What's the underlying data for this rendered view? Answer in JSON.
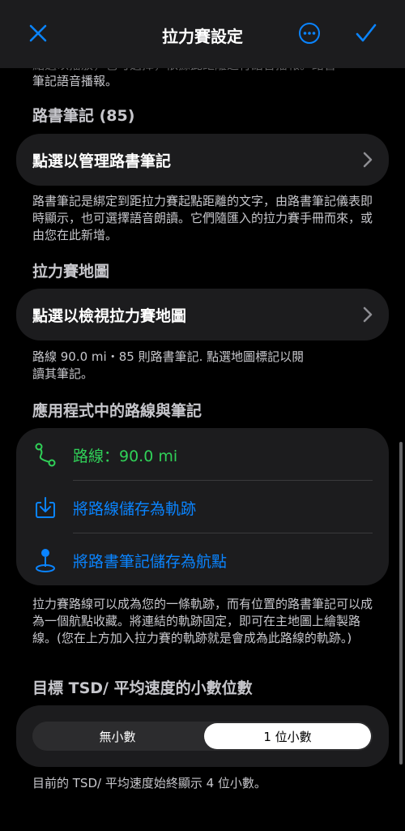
{
  "nav": {
    "title": "拉力賽設定",
    "close_icon": "close-icon",
    "more_icon": "more-icon",
    "done_icon": "checkmark-icon",
    "accent": "#0a84ff"
  },
  "clipped_text": {
    "line1": "點選以播放，也可選擇，依據此距離進行語音播報。路書",
    "line2": "筆記語音播報。"
  },
  "roadbook": {
    "header": "路書筆記 (85)",
    "button": "點選以管理路書筆記",
    "footnote": "路書筆記是綁定到距拉力賽起點距離的文字，由路書筆記儀表即時顯示，也可選擇語音朗讀。它們隨匯入的拉力賽手冊而來，或由您在此新增。"
  },
  "map": {
    "header": "拉力賽地圖",
    "button": "點選以檢視拉力賽地圖",
    "footnote": "路線 90.0 mi・85 則路書筆記. 點選地圖標記以閱讀其筆記。"
  },
  "route": {
    "header": "應用程式中的路線與筆記",
    "route_label": "路線：90.0 mi",
    "route_color": "#30d158",
    "save_track": "將路線儲存為軌跡",
    "save_waypoints": "將路書筆記儲存為航點",
    "link_color": "#0a84ff",
    "footnote": "拉力賽路線可以成為您的一條軌跡，而有位置的路書筆記可以成為一個航點收藏。將連結的軌跡固定，即可在主地圖上繪製路線。(您在上方加入拉力賽的軌跡就是會成為此路線的軌跡。)"
  },
  "decimals": {
    "header": "目標 TSD/ 平均速度的小數位數",
    "options": [
      "無小數",
      "1 位小數"
    ],
    "selected": "1 位小數",
    "footnote": "目前的 TSD/ 平均速度始終顯示 4 位小數。"
  }
}
